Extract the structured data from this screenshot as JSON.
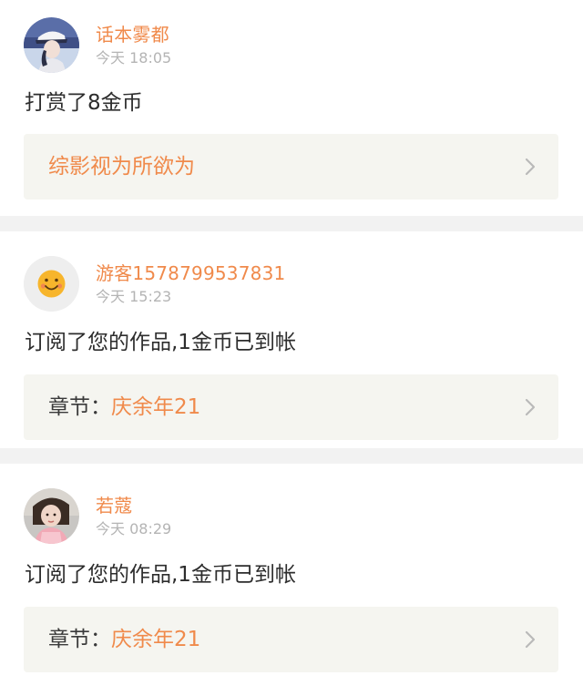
{
  "feed": [
    {
      "avatar_icon": "user-avatar-photo-icon",
      "username": "话本雾都",
      "time": "今天 18:05",
      "message": "打赏了8金币",
      "link_prefix": "",
      "link_title": "综影视为所欲为",
      "chevron_icon": "chevron-right-icon"
    },
    {
      "avatar_icon": "smiley-face-icon",
      "username": "游客1578799537831",
      "time": "今天 15:23",
      "message": "订阅了您的作品,1金币已到帐",
      "link_prefix": "章节：",
      "link_title": "庆余年21",
      "chevron_icon": "chevron-right-icon"
    },
    {
      "avatar_icon": "user-avatar-photo-icon",
      "username": "若蔻",
      "time": "今天 08:29",
      "message": "订阅了您的作品,1金币已到帐",
      "link_prefix": "章节：",
      "link_title": "庆余年21",
      "chevron_icon": "chevron-right-icon"
    }
  ],
  "colors": {
    "accent": "#f08a4b",
    "timestamp": "#b4b4b4",
    "card_background": "#f5f5f0",
    "divider": "#f2f2f2"
  }
}
